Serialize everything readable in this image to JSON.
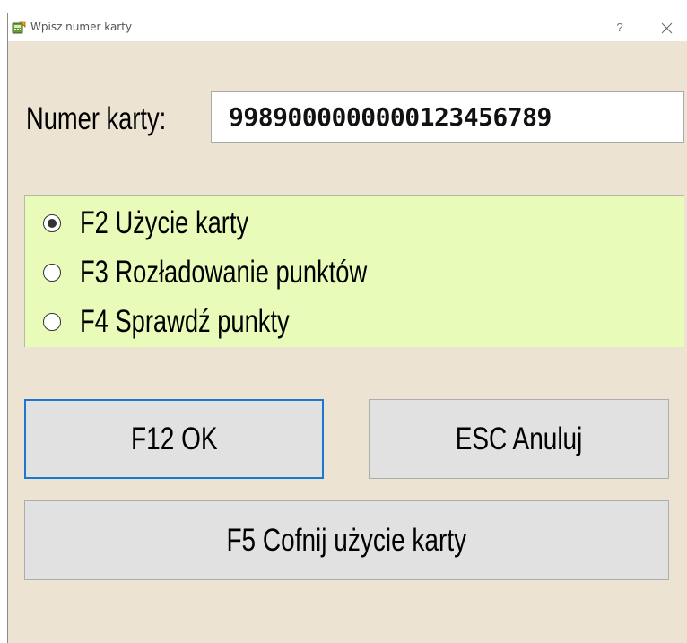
{
  "window": {
    "title": "Wpisz numer karty",
    "help_glyph": "?",
    "app_icon": "calculator-app-icon",
    "close_icon": "close-icon"
  },
  "card": {
    "label": "Numer karty:",
    "value": "9989000000000123456789"
  },
  "modes": {
    "selected_index": 0,
    "items": [
      {
        "label": "F2 Użycie karty",
        "checked": true
      },
      {
        "label": "F3 Rozładowanie punktów",
        "checked": false
      },
      {
        "label": "F4 Sprawdź punkty",
        "checked": false
      }
    ]
  },
  "buttons": {
    "ok": "F12 OK",
    "cancel": "ESC Anuluj",
    "undo": "F5 Cofnij użycie karty"
  },
  "colors": {
    "window_bg": "#ece3d3",
    "panel_bg": "#e9fbb9",
    "default_button_border": "#1b78d0",
    "button_bg": "#e1e1e1"
  }
}
